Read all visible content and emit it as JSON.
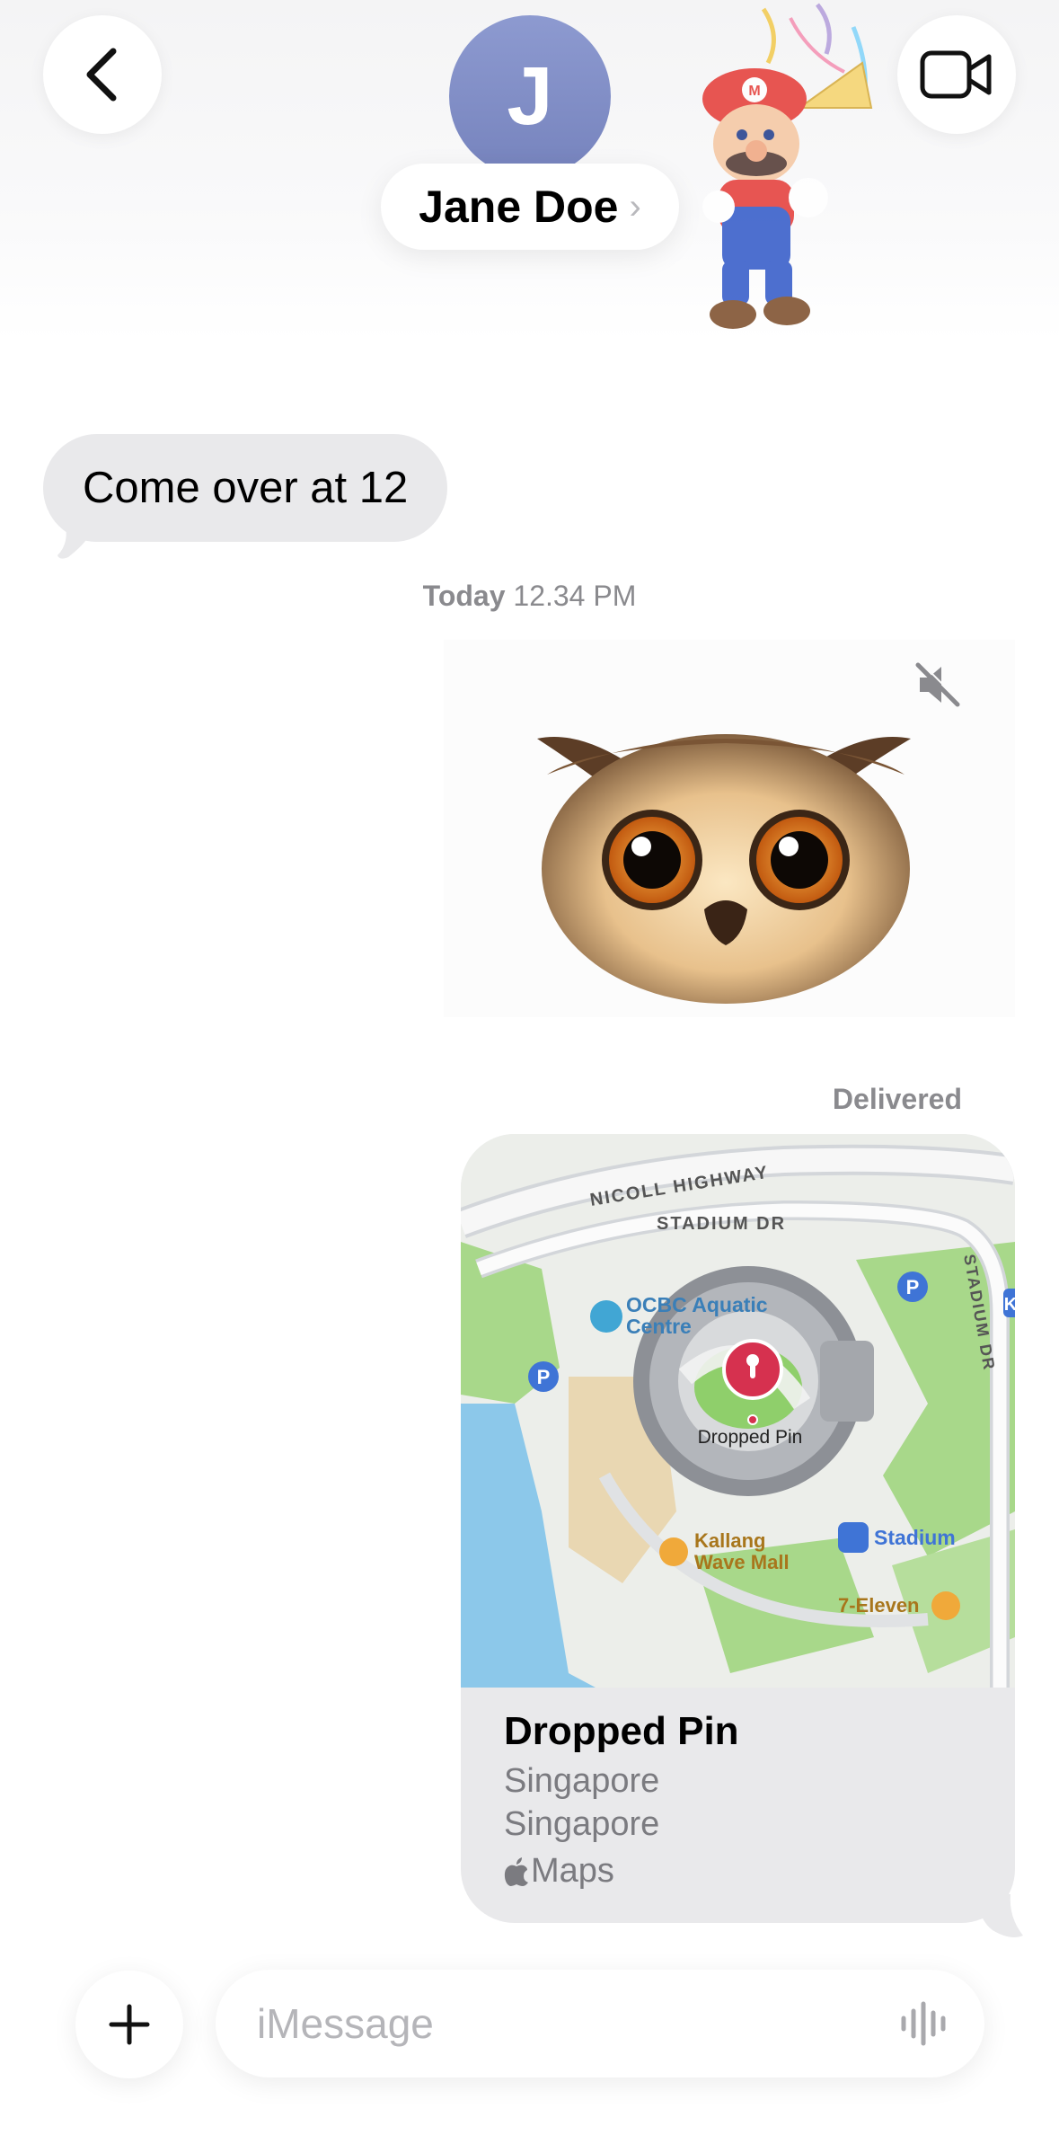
{
  "header": {
    "avatar_initial": "J",
    "contact_name": "Jane Doe",
    "contact_chevron": "›",
    "back_icon": "chevron-left-icon",
    "video_icon": "video-camera-icon"
  },
  "messages": {
    "incoming_text": "Come over at 12",
    "timestamp_day": "Today",
    "timestamp_time": "12.34 PM",
    "animoji_icon": "owl-animoji",
    "mute_icon": "speaker-muted-icon",
    "delivered_label": "Delivered"
  },
  "location_card": {
    "title": "Dropped Pin",
    "line1": "Singapore",
    "line2": "Singapore",
    "source": "Maps",
    "map_labels": {
      "road1": "NICOLL HIGHWAY",
      "road2": "STADIUM DR",
      "road3": "STADIUM DR",
      "poi1_line1": "OCBC Aquatic",
      "poi1_line2": "Centre",
      "pin_label": "Dropped Pin",
      "poi2_line1": "Kallang",
      "poi2_line2": "Wave Mall",
      "station": "Stadium",
      "shop": "7-Eleven",
      "parking": "P",
      "edge_badge": "K"
    }
  },
  "composer": {
    "placeholder": "iMessage",
    "plus_icon": "plus-icon",
    "audio_icon": "waveform-icon"
  },
  "colors": {
    "incoming_bubble": "#e9e9eb",
    "avatar": "#8591c8",
    "pin_red": "#d6314f",
    "water": "#8cc8ea",
    "park": "#a8d88a"
  }
}
